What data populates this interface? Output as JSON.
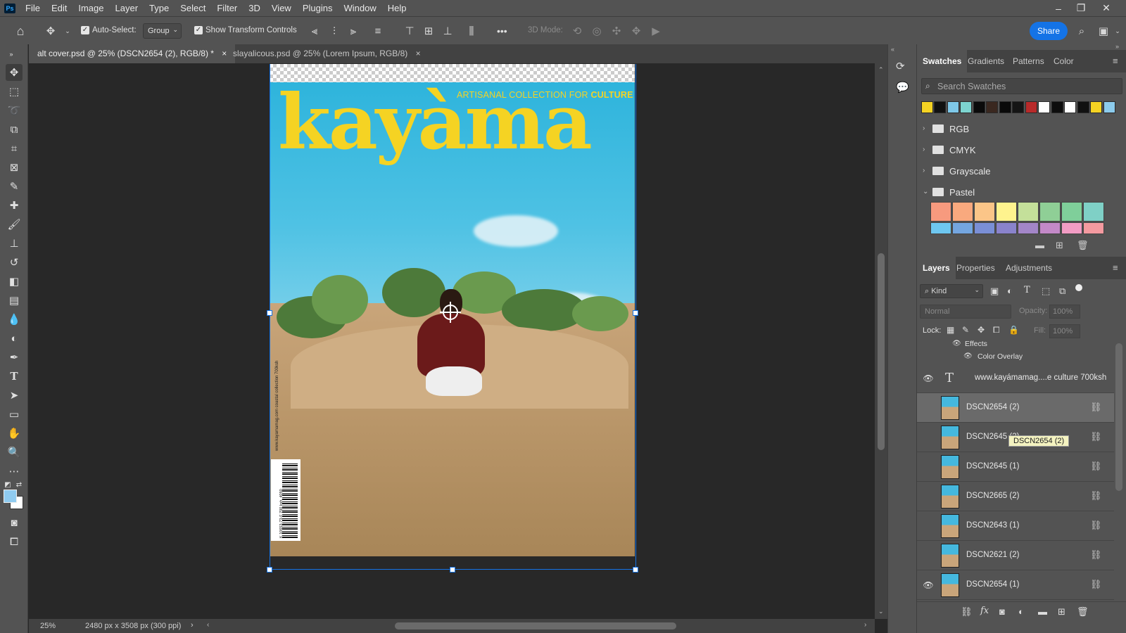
{
  "app": {
    "logo": "Ps"
  },
  "menu": [
    "File",
    "Edit",
    "Image",
    "Layer",
    "Type",
    "Select",
    "Filter",
    "3D",
    "View",
    "Plugins",
    "Window",
    "Help"
  ],
  "options": {
    "auto_select_label": "Auto-Select:",
    "auto_select_value": "Group",
    "show_transform_label": "Show Transform Controls",
    "mode_3d_label": "3D Mode:",
    "share_label": "Share",
    "more": "•••"
  },
  "tabs": [
    {
      "label": "alt cover.psd @ 25% (DSCN2654 (2), RGB/8) *",
      "close": "×"
    },
    {
      "label": "slayalicous.psd @ 25% (Lorem Ipsum, RGB/8)",
      "close": "×"
    }
  ],
  "artwork": {
    "title": "kayàma",
    "tagline_pre": "ARTISANAL COLLECTION FOR ",
    "tagline_bold": "CULTURE",
    "side_text": "www.kayamamag.com coastal collection 700ksh",
    "barcode_text": "K 10653-73-F 700 ksh. 4050"
  },
  "status": {
    "zoom": "25%",
    "dimensions": "2480 px x 3508 px (300 ppi)",
    "arrow": "›"
  },
  "swatches_panel": {
    "tabs": [
      "Swatches",
      "Gradients",
      "Patterns",
      "Color"
    ],
    "search_placeholder": "Search Swatches",
    "recent_colors": [
      "#f5d323",
      "#111111",
      "#7fc8e8",
      "#7dd4d0",
      "#0a0a0a",
      "#3a2820",
      "#0a0a0a",
      "#151515",
      "#b82a2a",
      "#ffffff",
      "#0d0d0d",
      "#ffffff",
      "#111111",
      "#f5d323",
      "#8ccbec"
    ],
    "folders": [
      "RGB",
      "CMYK",
      "Grayscale",
      "Pastel"
    ],
    "pastel_row1": [
      "#f79a7e",
      "#f9a97e",
      "#fbc588",
      "#fef38e",
      "#c4e09a",
      "#8fcf96",
      "#7fcf9a",
      "#7fd0c6"
    ],
    "pastel_row2": [
      "#6ec7f0",
      "#74a6e0",
      "#7a8fd6",
      "#8a83cc",
      "#a386c8",
      "#c389c8",
      "#f29cc4",
      "#f49aa0"
    ]
  },
  "layers_panel": {
    "tabs": [
      "Layers",
      "Properties",
      "Adjustments"
    ],
    "filter_label": "Kind",
    "blend_mode": "Normal",
    "opacity_label": "Opacity:",
    "opacity_value": "100%",
    "lock_label": "Lock:",
    "fill_label": "Fill:",
    "fill_value": "100%",
    "effects_label": "Effects",
    "color_overlay_label": "Color Overlay",
    "text_layer": "www.kayámamag....e culture 700ksh",
    "layers": [
      {
        "name": "DSCN2654 (2)",
        "visible": false,
        "selected": true
      },
      {
        "name": "DSCN2645 (2)",
        "visible": false,
        "selected": false
      },
      {
        "name": "DSCN2645 (1)",
        "visible": false,
        "selected": false
      },
      {
        "name": "DSCN2665 (2)",
        "visible": false,
        "selected": false
      },
      {
        "name": "DSCN2643 (1)",
        "visible": false,
        "selected": false
      },
      {
        "name": "DSCN2621 (2)",
        "visible": false,
        "selected": false
      },
      {
        "name": "DSCN2654 (1)",
        "visible": true,
        "selected": false
      }
    ],
    "tooltip": "DSCN2654 (2)"
  }
}
